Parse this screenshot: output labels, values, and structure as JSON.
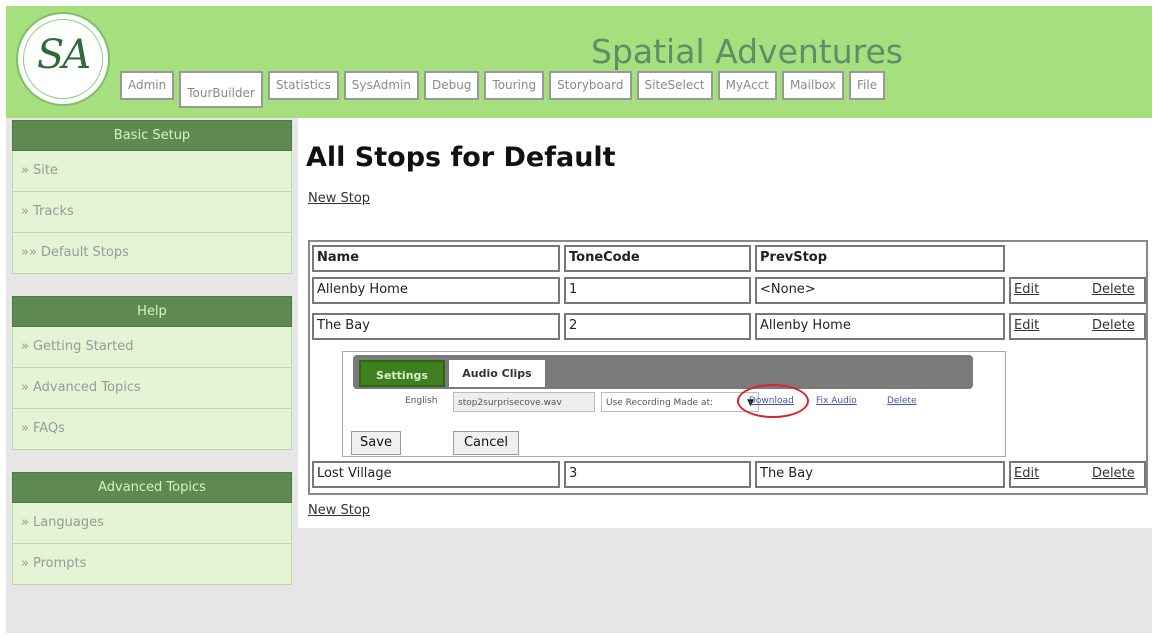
{
  "header": {
    "logo_text": "SA",
    "site_title": "Spatial Adventures",
    "tabs": [
      {
        "label": "Admin"
      },
      {
        "label": "TourBuilder"
      },
      {
        "label": "Statistics"
      },
      {
        "label": "SysAdmin"
      },
      {
        "label": "Debug"
      },
      {
        "label": "Touring"
      },
      {
        "label": "Storyboard"
      },
      {
        "label": "SiteSelect"
      },
      {
        "label": "MyAcct"
      },
      {
        "label": "Mailbox"
      },
      {
        "label": "File"
      }
    ],
    "active_tab": "TourBuilder"
  },
  "sidebar": {
    "basic_setup": {
      "title": "Basic Setup",
      "items": [
        {
          "arrow": "»",
          "label": "Site"
        },
        {
          "arrow": "»",
          "label": "Tracks"
        },
        {
          "arrow": "»»",
          "label": "Default Stops"
        }
      ]
    },
    "help": {
      "title": "Help",
      "items": [
        {
          "arrow": "»",
          "label": "Getting Started"
        },
        {
          "arrow": "»",
          "label": "Advanced Topics"
        },
        {
          "arrow": "»",
          "label": "FAQs"
        }
      ]
    },
    "advanced_topics": {
      "title": "Advanced Topics",
      "items": [
        {
          "arrow": "»",
          "label": "Languages"
        },
        {
          "arrow": "»",
          "label": "Prompts"
        }
      ]
    }
  },
  "main": {
    "title": "All Stops for Default",
    "new_stop_label": "New Stop",
    "columns": [
      "Name",
      "ToneCode",
      "PrevStop"
    ],
    "rows": [
      {
        "name": "Allenby Home",
        "tonecode": "1",
        "prevstop": "<None>",
        "edit": "Edit",
        "delete": "Delete"
      },
      {
        "name": "The Bay",
        "tonecode": "2",
        "prevstop": "Allenby Home",
        "edit": "Edit",
        "delete": "Delete"
      },
      {
        "name": "Lost Village",
        "tonecode": "3",
        "prevstop": "The Bay",
        "edit": "Edit",
        "delete": "Delete"
      }
    ],
    "editor": {
      "tabs": [
        "Settings",
        "Audio Clips"
      ],
      "active_tab": "Settings",
      "language": "English",
      "filename": "stop2surprisecove.wav",
      "recording_select": "Use Recording Made at:",
      "select_arrow": "▼",
      "download_label": "Download",
      "fix_audio_label": "Fix Audio",
      "delete_label": "Delete",
      "save_label": "Save",
      "cancel_label": "Cancel",
      "highlight_color": "#d8232a"
    }
  },
  "colors": {
    "header_bg": "#a6e07e",
    "sidebar_head_bg": "#5e8a50",
    "sidebar_item_bg": "#e3f5d4",
    "settings_tab_bg": "#3f7f1f"
  }
}
